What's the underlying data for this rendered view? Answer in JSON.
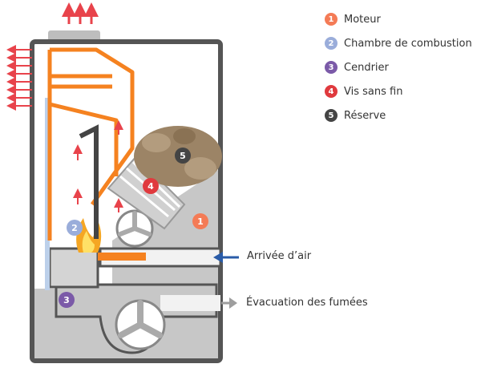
{
  "colors": {
    "moteur": "#f47b56",
    "chambre": "#9aadda",
    "cendrier": "#7b5aa8",
    "vis": "#e03a3e",
    "reserve": "#444444",
    "pipe": "#f58220",
    "arrow_red": "#e8434b",
    "arrow_blue": "#2a5ca8",
    "arrow_gray": "#9e9e9e",
    "wall": "#555555",
    "body": "#c7c7c7",
    "pellet": "#9c8466"
  },
  "legend": [
    {
      "number": "1",
      "label": "Moteur",
      "color": "#f47b56"
    },
    {
      "number": "2",
      "label": "Chambre de combustion",
      "color": "#9aadda"
    },
    {
      "number": "3",
      "label": "Cendrier",
      "color": "#7b5aa8"
    },
    {
      "number": "4",
      "label": "Vis sans fin",
      "color": "#e03a3e"
    },
    {
      "number": "5",
      "label": "Réserve",
      "color": "#444444"
    }
  ],
  "markers": [
    {
      "number": "1",
      "color": "#f47b56"
    },
    {
      "number": "2",
      "color": "#9aadda"
    },
    {
      "number": "3",
      "color": "#7b5aa8"
    },
    {
      "number": "4",
      "color": "#e03a3e"
    },
    {
      "number": "5",
      "color": "#444444"
    }
  ],
  "callouts": {
    "air_inlet": "Arrivée d’air",
    "exhaust": "Évacuation des fumées"
  }
}
